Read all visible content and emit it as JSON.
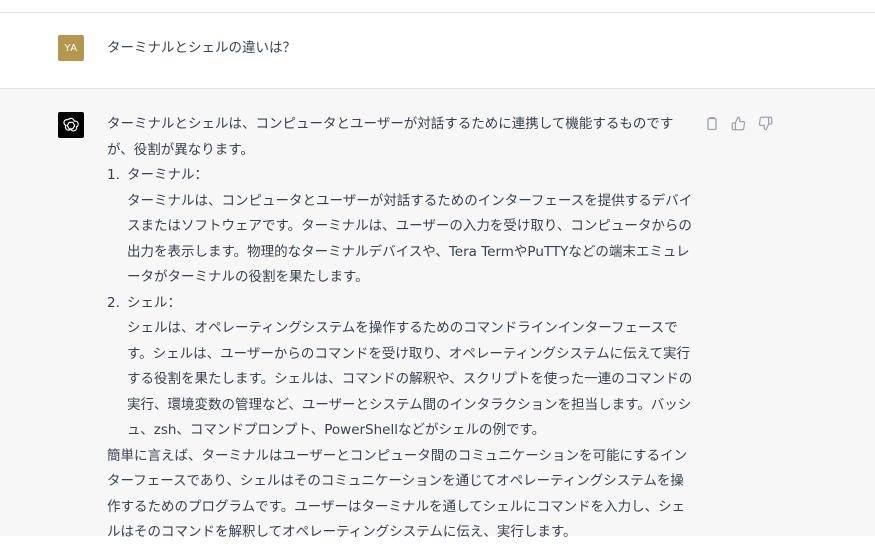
{
  "colors": {
    "user_avatar_bg": "#b6964f",
    "bot_avatar_bg": "#000000",
    "assistant_bg": "#f7f7f8"
  },
  "user": {
    "avatar": "YA",
    "message": "ターミナルとシェルの違いは？"
  },
  "assistant": {
    "avatar_icon": "openai-logo-icon",
    "intro": "ターミナルとシェルは、コンピュータとユーザーが対話するために連携して機能するものですが、役割が異なります。",
    "items": [
      {
        "number": "1.",
        "title": "ターミナル：",
        "body": "ターミナルは、コンピュータとユーザーが対話するためのインターフェースを提供するデバイスまたはソフトウェアです。ターミナルは、ユーザーの入力を受け取り、コンピュータからの出力を表示します。物理的なターミナルデバイスや、Tera TermやPuTTYなどの端末エミュレータがターミナルの役割を果たします。"
      },
      {
        "number": "2.",
        "title": "シェル：",
        "body": "シェルは、オペレーティングシステムを操作するためのコマンドラインインターフェースです。シェルは、ユーザーからのコマンドを受け取り、オペレーティングシステムに伝えて実行する役割を果たします。シェルは、コマンドの解釈や、スクリプトを使った一連のコマンドの実行、環境変数の管理など、ユーザーとシステム間のインタラクションを担当します。バッシュ、zsh、コマンドプロンプト、PowerShellなどがシェルの例です。"
      }
    ],
    "summary": "簡単に言えば、ターミナルはユーザーとコンピュータ間のコミュニケーションを可能にするインターフェースであり、シェルはそのコミュニケーションを通じてオペレーティングシステムを操作するためのプログラムです。ユーザーはターミナルを通してシェルにコマンドを入力し、シェルはそのコマンドを解釈してオペレーティングシステムに伝え、実行します。",
    "actions": [
      "copy-icon",
      "thumbs-up-icon",
      "thumbs-down-icon"
    ]
  }
}
